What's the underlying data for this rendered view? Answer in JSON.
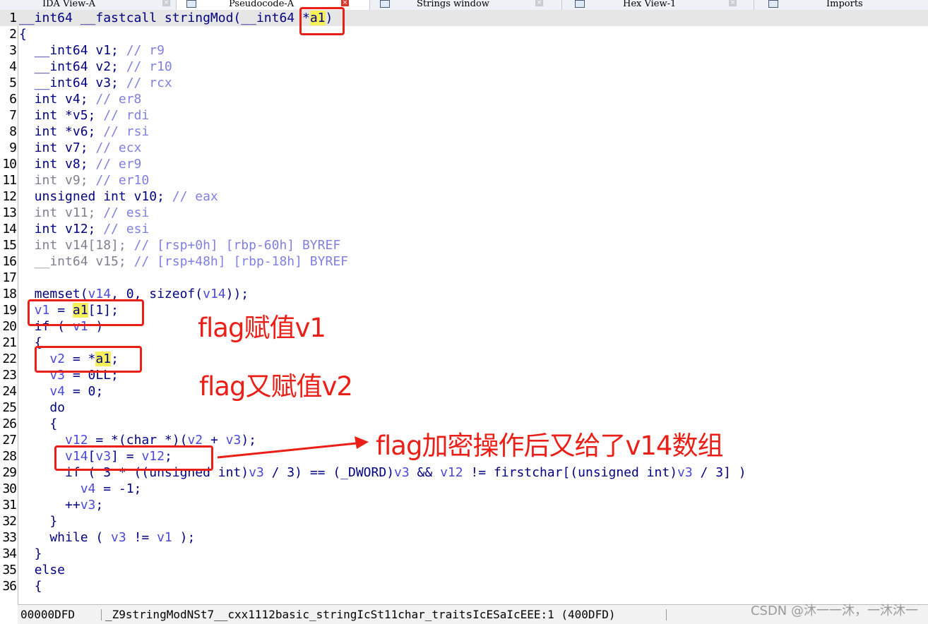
{
  "tabs": [
    {
      "label": "IDA View-A",
      "active": false
    },
    {
      "label": "Pseudocode-A",
      "active": true
    },
    {
      "label": "Strings window",
      "active": false
    },
    {
      "label": "Hex View-1",
      "active": false
    },
    {
      "label": "Imports",
      "active": false
    }
  ],
  "tab_close_glyph": "×",
  "code": {
    "line_numbers": [
      "1",
      "2",
      "3",
      "4",
      "5",
      "6",
      "7",
      "8",
      "9",
      "10",
      "11",
      "12",
      "13",
      "14",
      "15",
      "16",
      "17",
      "18",
      "19",
      "20",
      "21",
      "22",
      "23",
      "24",
      "25",
      "26",
      "27",
      "28",
      "29",
      "30",
      "31",
      "32",
      "33",
      "34",
      "35",
      "36"
    ],
    "l1": {
      "a": "__int64 __fastcall stringMod(__int64 *",
      "b": "a1",
      "c": ")"
    },
    "l2": "{",
    "l3": {
      "a": "  __int64 v1; ",
      "c": "// r9"
    },
    "l4": {
      "a": "  __int64 v2; ",
      "c": "// r10"
    },
    "l5": {
      "a": "  __int64 v3; ",
      "c": "// rcx"
    },
    "l6": {
      "a": "  int v4; ",
      "c": "// er8"
    },
    "l7": {
      "a": "  int *v5; ",
      "c": "// rdi"
    },
    "l8": {
      "a": "  int *v6; ",
      "c": "// rsi"
    },
    "l9": {
      "a": "  int v7; ",
      "c": "// ecx"
    },
    "l10": {
      "a": "  int v8; ",
      "c": "// er9"
    },
    "l11": {
      "a": "  int v9; ",
      "c": "// er10"
    },
    "l12": {
      "a": "  unsigned int v10; ",
      "c": "// eax"
    },
    "l13": {
      "a": "  int v11; ",
      "c": "// esi"
    },
    "l14": {
      "a": "  int v12; ",
      "c": "// esi"
    },
    "l15": {
      "a": "  int v14[18]; ",
      "c": "// [rsp+0h] [rbp-60h] BYREF"
    },
    "l16": {
      "a": "  __int64 v15; ",
      "c": "// [rsp+48h] [rbp-18h] BYREF"
    },
    "l17": "",
    "l18": {
      "a": "  memset(",
      "v": "v14",
      "b": ", 0, sizeof(",
      "v2": "v14",
      "c": "));"
    },
    "l19": {
      "v": "  v1",
      "a": " = ",
      "h": "a1",
      "b": "[1];"
    },
    "l20": {
      "a": "  if ( ",
      "v": "v1",
      "b": " )"
    },
    "l21": "  {",
    "l22": {
      "v": "    v2",
      "a": " = *",
      "h": "a1",
      "b": ";"
    },
    "l23": {
      "v": "    v3",
      "a": " = 0LL;"
    },
    "l24": {
      "v": "    v4",
      "a": " = 0;"
    },
    "l25": "    do",
    "l26": "    {",
    "l27": {
      "v": "      v12",
      "a": " = *(char *)(",
      "v2": "v2",
      "b": " + ",
      "v3": "v3",
      "c": ");"
    },
    "l28": {
      "v": "      v14",
      "a": "[",
      "v2": "v3",
      "b": "] = ",
      "v3": "v12",
      "c": ";"
    },
    "l29": {
      "a": "      if ( 3 * ((unsigned int)",
      "v": "v3",
      "b": " / 3) == (_DWORD)",
      "v2": "v3",
      "c": " && ",
      "v3": "v12",
      "d": " != firstchar[(unsigned int)",
      "v4": "v3",
      "e": " / 3] )"
    },
    "l30": {
      "v": "        v4",
      "a": " = -1;"
    },
    "l31": {
      "a": "      ++",
      "v": "v3",
      "b": ";"
    },
    "l32": "    }",
    "l33": {
      "a": "    while ( ",
      "v": "v3",
      "b": " != ",
      "v2": "v1",
      "c": " );"
    },
    "l34": "  }",
    "l35": "  else",
    "l36": "  {"
  },
  "annotations": {
    "flag_v1": "flag赋值v1",
    "flag_v2": "flag又赋值v2",
    "flag_v14": "flag加密操作后又给了v14数组"
  },
  "status": {
    "address": "00000DFD",
    "symbol": "_Z9stringModNSt7__cxx1112basic_stringIcSt11char_traitsIcESaIcEEE:1 (400DFD)"
  },
  "watermark": "CSDN @沐一一沐，一沐沐一",
  "colors": {
    "annotation": "#ea1f18",
    "highlight": "#f5f05a",
    "keyword": "#000080",
    "variable": "#4a4ad8",
    "comment": "#8080e0"
  }
}
